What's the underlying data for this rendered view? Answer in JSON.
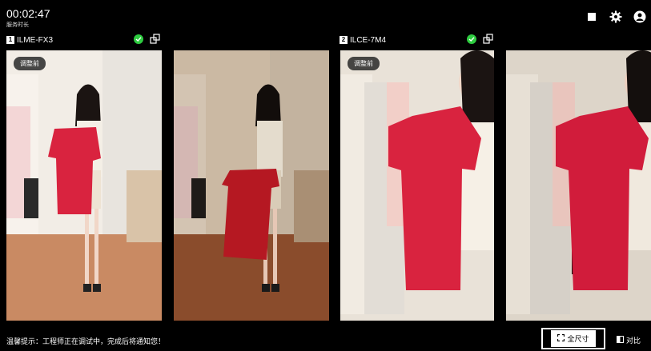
{
  "timer": {
    "time": "00:02:47",
    "label": "服务时长"
  },
  "cameras": [
    {
      "index": "1",
      "name": "ILME-FX3"
    },
    {
      "index": "2",
      "name": "ILCE-7M4"
    }
  ],
  "panels": {
    "before_badge": "调整前"
  },
  "bottom": {
    "tip": "温馨提示：工程师正在调试中，完成后将通知您！",
    "full_size_label": "全尺寸",
    "compare_label": "对比"
  },
  "colors": {
    "status_ok": "#2ecc40",
    "background": "#000000",
    "dress_red": "#d9233f"
  },
  "icons": [
    "stop-icon",
    "gear-icon",
    "user-icon",
    "check-icon",
    "swap-icon",
    "fullscreen-icon",
    "compare-icon"
  ]
}
